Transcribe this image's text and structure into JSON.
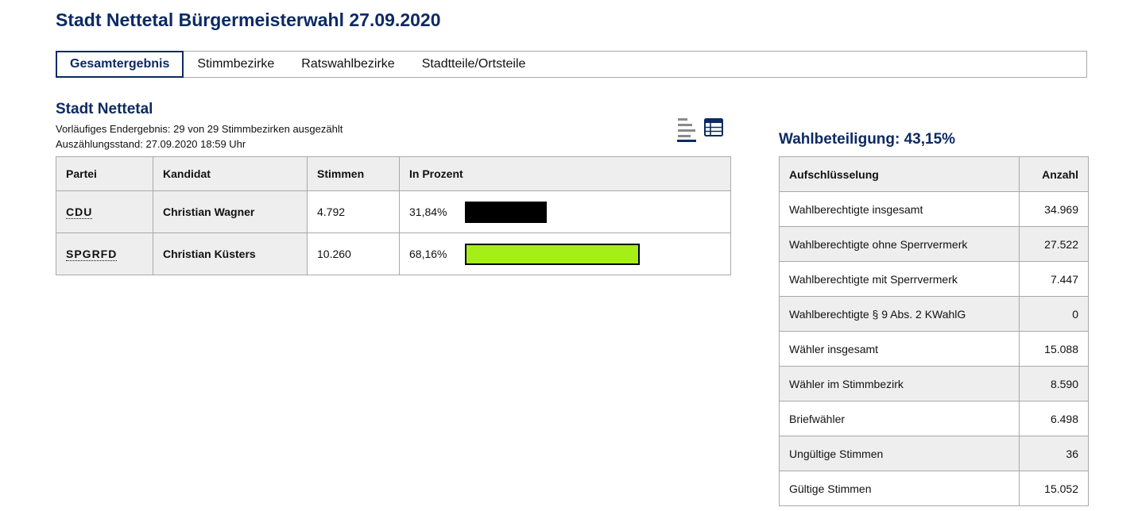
{
  "page": {
    "title": "Stadt Nettetal Bürgermeisterwahl 27.09.2020"
  },
  "tabs": [
    {
      "label": "Gesamtergebnis",
      "active": true
    },
    {
      "label": "Stimmbezirke",
      "active": false
    },
    {
      "label": "Ratswahlbezirke",
      "active": false
    },
    {
      "label": "Stadtteile/Ortsteile",
      "active": false
    }
  ],
  "section": {
    "title": "Stadt Nettetal",
    "status": "Vorläufiges Endergebnis: 29 von 29 Stimmbezirken ausgezählt",
    "count_state": "Auszählungsstand: 27.09.2020 18:59 Uhr"
  },
  "view_toggle": {
    "chart_icon": "bar-chart-icon",
    "table_icon": "table-icon",
    "accent_color": "#0d2a63"
  },
  "results": {
    "headers": {
      "party": "Partei",
      "candidate": "Kandidat",
      "votes": "Stimmen",
      "percent": "In Prozent"
    },
    "rows": [
      {
        "party": "CDU",
        "candidate": "Christian Wagner",
        "votes": "4.792",
        "percent_label": "31,84%",
        "percent": 31.84,
        "bar_color": "#000000",
        "bar_outline": false
      },
      {
        "party": "SPGRFD",
        "candidate": "Christian Küsters",
        "votes": "10.260",
        "percent_label": "68,16%",
        "percent": 68.16,
        "bar_color": "#a6ef16",
        "bar_outline": true
      }
    ]
  },
  "turnout": {
    "title": "Wahlbeteiligung: 43,15%",
    "headers": {
      "label": "Aufschlüsselung",
      "count": "Anzahl"
    },
    "rows": [
      {
        "label": "Wahlberechtigte insgesamt",
        "value": "34.969"
      },
      {
        "label": "Wahlberechtigte ohne Sperrvermerk",
        "value": "27.522"
      },
      {
        "label": "Wahlberechtigte mit Sperrvermerk",
        "value": "7.447"
      },
      {
        "label": "Wahlberechtigte § 9 Abs. 2 KWahlG",
        "value": "0"
      },
      {
        "label": "Wähler insgesamt",
        "value": "15.088"
      },
      {
        "label": "Wähler im Stimmbezirk",
        "value": "8.590"
      },
      {
        "label": "Briefwähler",
        "value": "6.498"
      },
      {
        "label": "Ungültige Stimmen",
        "value": "36"
      },
      {
        "label": "Gültige Stimmen",
        "value": "15.052"
      }
    ]
  }
}
